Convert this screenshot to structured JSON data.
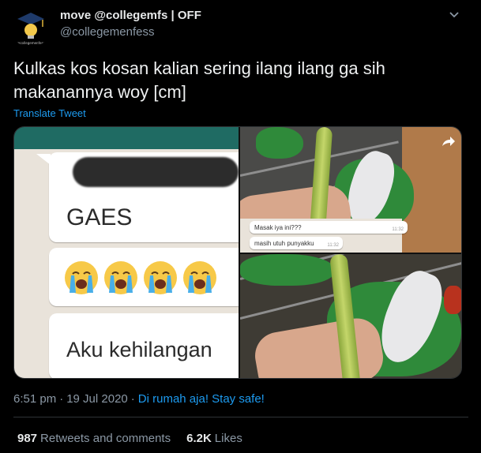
{
  "user": {
    "display_name": "move @collegemfs | OFF",
    "handle": "@collegemenfess",
    "avatar_text": "@collegemenfess"
  },
  "tweet": {
    "text": "Kulkas kos kosan kalian sering ilang ilang ga sih makanannya woy [cm]",
    "translate_label": "Translate Tweet"
  },
  "media": {
    "chat_text_1": "GAES",
    "chat_text_2": "Aku kehilangan",
    "emoji": [
      "crying-face",
      "crying-face",
      "crying-face",
      "crying-face"
    ],
    "caption_1": "Masak iya ini???",
    "caption_1_time": "11:32",
    "caption_2": "masih utuh punyakku",
    "caption_2_time": "11:32"
  },
  "meta": {
    "time": "6:51 pm",
    "separator": "·",
    "date": "19 Jul 2020",
    "separator2": "·",
    "source": "Di rumah aja! Stay safe!"
  },
  "stats": {
    "retweets_count": "987",
    "retweets_label": "Retweets and comments",
    "likes_count": "6.2K",
    "likes_label": "Likes"
  },
  "colors": {
    "background": "#000000",
    "accent": "#1d9bf0",
    "muted": "#8b98a5",
    "divider": "#2f3336"
  }
}
